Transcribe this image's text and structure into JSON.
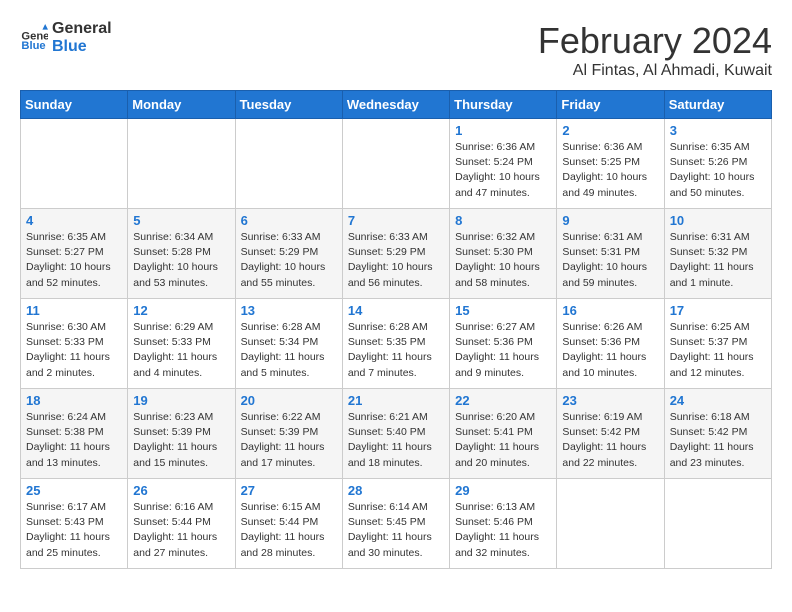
{
  "header": {
    "logo_general": "General",
    "logo_blue": "Blue",
    "month_year": "February 2024",
    "location": "Al Fintas, Al Ahmadi, Kuwait"
  },
  "days_of_week": [
    "Sunday",
    "Monday",
    "Tuesday",
    "Wednesday",
    "Thursday",
    "Friday",
    "Saturday"
  ],
  "weeks": [
    [
      {
        "day": "",
        "info": ""
      },
      {
        "day": "",
        "info": ""
      },
      {
        "day": "",
        "info": ""
      },
      {
        "day": "",
        "info": ""
      },
      {
        "day": "1",
        "info": "Sunrise: 6:36 AM\nSunset: 5:24 PM\nDaylight: 10 hours and 47 minutes."
      },
      {
        "day": "2",
        "info": "Sunrise: 6:36 AM\nSunset: 5:25 PM\nDaylight: 10 hours and 49 minutes."
      },
      {
        "day": "3",
        "info": "Sunrise: 6:35 AM\nSunset: 5:26 PM\nDaylight: 10 hours and 50 minutes."
      }
    ],
    [
      {
        "day": "4",
        "info": "Sunrise: 6:35 AM\nSunset: 5:27 PM\nDaylight: 10 hours and 52 minutes."
      },
      {
        "day": "5",
        "info": "Sunrise: 6:34 AM\nSunset: 5:28 PM\nDaylight: 10 hours and 53 minutes."
      },
      {
        "day": "6",
        "info": "Sunrise: 6:33 AM\nSunset: 5:29 PM\nDaylight: 10 hours and 55 minutes."
      },
      {
        "day": "7",
        "info": "Sunrise: 6:33 AM\nSunset: 5:29 PM\nDaylight: 10 hours and 56 minutes."
      },
      {
        "day": "8",
        "info": "Sunrise: 6:32 AM\nSunset: 5:30 PM\nDaylight: 10 hours and 58 minutes."
      },
      {
        "day": "9",
        "info": "Sunrise: 6:31 AM\nSunset: 5:31 PM\nDaylight: 10 hours and 59 minutes."
      },
      {
        "day": "10",
        "info": "Sunrise: 6:31 AM\nSunset: 5:32 PM\nDaylight: 11 hours and 1 minute."
      }
    ],
    [
      {
        "day": "11",
        "info": "Sunrise: 6:30 AM\nSunset: 5:33 PM\nDaylight: 11 hours and 2 minutes."
      },
      {
        "day": "12",
        "info": "Sunrise: 6:29 AM\nSunset: 5:33 PM\nDaylight: 11 hours and 4 minutes."
      },
      {
        "day": "13",
        "info": "Sunrise: 6:28 AM\nSunset: 5:34 PM\nDaylight: 11 hours and 5 minutes."
      },
      {
        "day": "14",
        "info": "Sunrise: 6:28 AM\nSunset: 5:35 PM\nDaylight: 11 hours and 7 minutes."
      },
      {
        "day": "15",
        "info": "Sunrise: 6:27 AM\nSunset: 5:36 PM\nDaylight: 11 hours and 9 minutes."
      },
      {
        "day": "16",
        "info": "Sunrise: 6:26 AM\nSunset: 5:36 PM\nDaylight: 11 hours and 10 minutes."
      },
      {
        "day": "17",
        "info": "Sunrise: 6:25 AM\nSunset: 5:37 PM\nDaylight: 11 hours and 12 minutes."
      }
    ],
    [
      {
        "day": "18",
        "info": "Sunrise: 6:24 AM\nSunset: 5:38 PM\nDaylight: 11 hours and 13 minutes."
      },
      {
        "day": "19",
        "info": "Sunrise: 6:23 AM\nSunset: 5:39 PM\nDaylight: 11 hours and 15 minutes."
      },
      {
        "day": "20",
        "info": "Sunrise: 6:22 AM\nSunset: 5:39 PM\nDaylight: 11 hours and 17 minutes."
      },
      {
        "day": "21",
        "info": "Sunrise: 6:21 AM\nSunset: 5:40 PM\nDaylight: 11 hours and 18 minutes."
      },
      {
        "day": "22",
        "info": "Sunrise: 6:20 AM\nSunset: 5:41 PM\nDaylight: 11 hours and 20 minutes."
      },
      {
        "day": "23",
        "info": "Sunrise: 6:19 AM\nSunset: 5:42 PM\nDaylight: 11 hours and 22 minutes."
      },
      {
        "day": "24",
        "info": "Sunrise: 6:18 AM\nSunset: 5:42 PM\nDaylight: 11 hours and 23 minutes."
      }
    ],
    [
      {
        "day": "25",
        "info": "Sunrise: 6:17 AM\nSunset: 5:43 PM\nDaylight: 11 hours and 25 minutes."
      },
      {
        "day": "26",
        "info": "Sunrise: 6:16 AM\nSunset: 5:44 PM\nDaylight: 11 hours and 27 minutes."
      },
      {
        "day": "27",
        "info": "Sunrise: 6:15 AM\nSunset: 5:44 PM\nDaylight: 11 hours and 28 minutes."
      },
      {
        "day": "28",
        "info": "Sunrise: 6:14 AM\nSunset: 5:45 PM\nDaylight: 11 hours and 30 minutes."
      },
      {
        "day": "29",
        "info": "Sunrise: 6:13 AM\nSunset: 5:46 PM\nDaylight: 11 hours and 32 minutes."
      },
      {
        "day": "",
        "info": ""
      },
      {
        "day": "",
        "info": ""
      }
    ]
  ]
}
